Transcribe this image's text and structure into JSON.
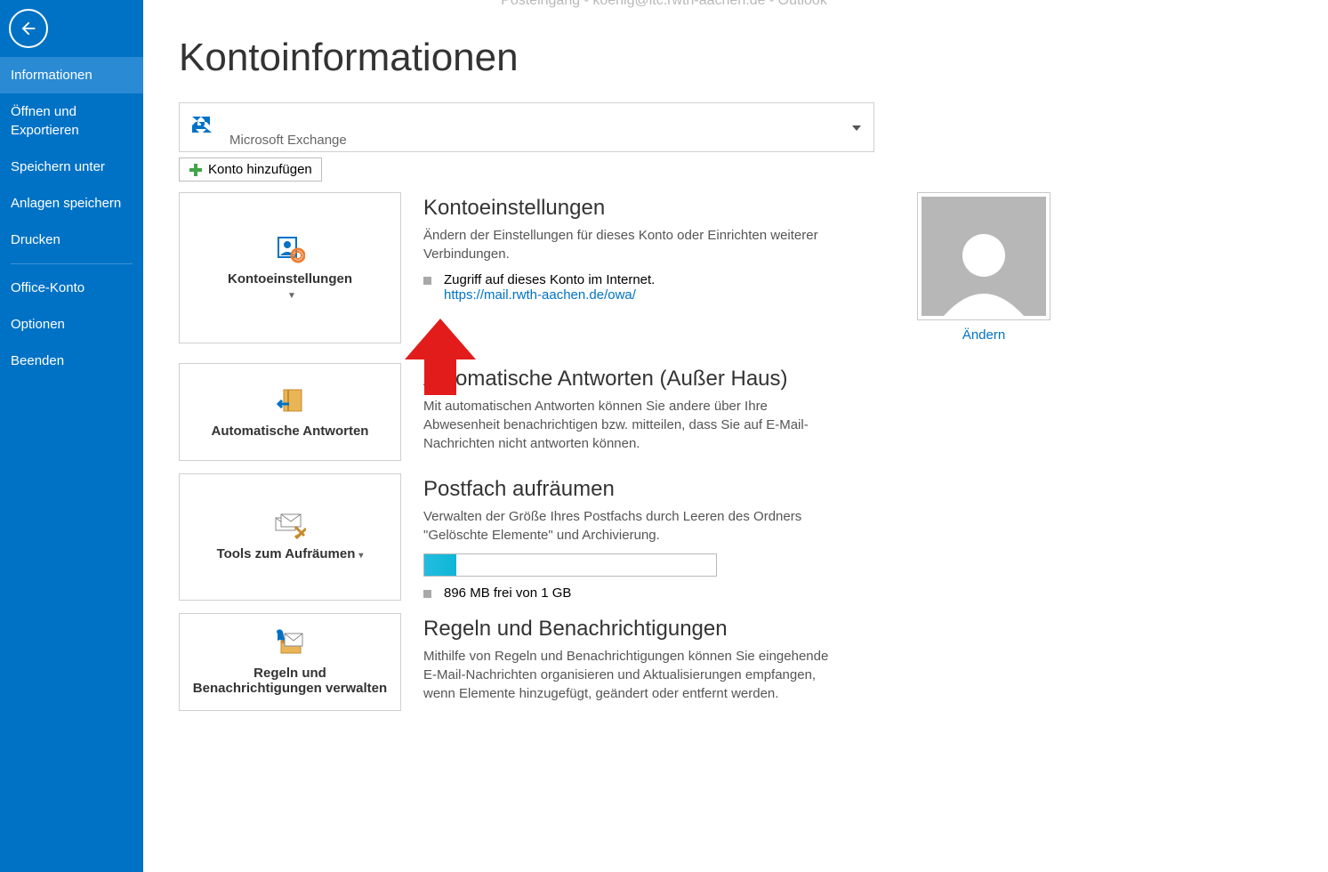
{
  "window_title": "Posteingang - koenig@itc.rwth-aachen.de - Outlook",
  "sidebar": {
    "items": [
      {
        "label": "Informationen",
        "active": true
      },
      {
        "label": "Öffnen und Exportieren",
        "active": false
      },
      {
        "label": "Speichern unter",
        "active": false
      },
      {
        "label": "Anlagen speichern",
        "active": false
      },
      {
        "label": "Drucken",
        "active": false
      }
    ],
    "bottom_items": [
      {
        "label": "Office-Konto"
      },
      {
        "label": "Optionen"
      },
      {
        "label": "Beenden"
      }
    ]
  },
  "page_title": "Kontoinformationen",
  "account": {
    "type": "Microsoft Exchange"
  },
  "add_account_label": "Konto hinzufügen",
  "sections": {
    "settings": {
      "button": "Kontoeinstellungen",
      "title": "Kontoeinstellungen",
      "desc": "Ändern der Einstellungen für dieses Konto oder Einrichten weiterer Verbindungen.",
      "sub1": "Zugriff auf dieses Konto im Internet.",
      "link": "https://mail.rwth-aachen.de/owa/",
      "change_link": "Ändern"
    },
    "autoreply": {
      "button": "Automatische Antworten",
      "title": "Automatische Antworten (Außer Haus)",
      "desc": "Mit automatischen Antworten können Sie andere über Ihre Abwesenheit benachrichtigen bzw. mitteilen, dass Sie auf E-Mail-Nachrichten nicht antworten können."
    },
    "cleanup": {
      "button": "Tools zum Aufräumen",
      "title": "Postfach aufräumen",
      "desc": "Verwalten der Größe Ihres Postfachs durch Leeren des Ordners \"Gelöschte Elemente\" und Archivierung.",
      "storage_text": "896 MB frei von 1 GB",
      "used_percent": 11
    },
    "rules": {
      "button": "Regeln und Benachrichtigungen verwalten",
      "title": "Regeln und Benachrichtigungen",
      "desc": "Mithilfe von Regeln und Benachrichtigungen können Sie eingehende E-Mail-Nachrichten organisieren und Aktualisierungen empfangen, wenn Elemente hinzugefügt, geändert oder entfernt werden."
    }
  }
}
